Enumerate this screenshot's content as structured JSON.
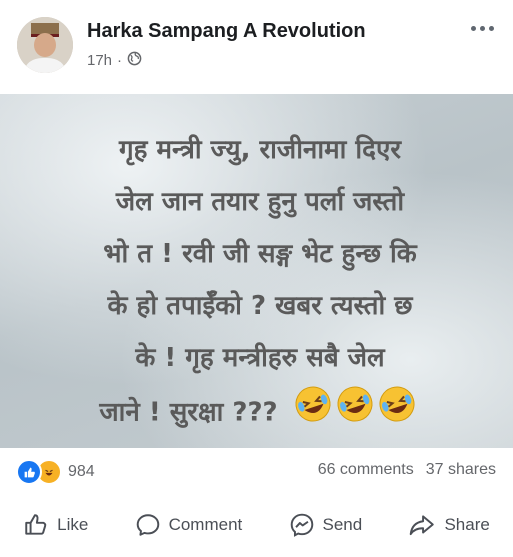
{
  "post": {
    "author": "Harka Sampang A Revolution",
    "time": "17h",
    "privacy_icon": "globe-icon",
    "text_lines": [
      "गृह मन्त्री ज्यु, राजीनामा दिएर",
      "जेल जान तयार हुनु पर्ला जस्तो",
      "भो त ! रवी जी सङ्ग भेट हुन्छ कि",
      "के हो तपाईँको ? खबर त्यस्तो छ",
      "के ! गृह मन्त्रीहरु सबै जेल",
      "जाने ! सुरक्षा ???"
    ],
    "emoji_count": 3,
    "text_color": "#5a5a5a"
  },
  "stats": {
    "reaction_count": "984",
    "comments": "66 comments",
    "shares": "37 shares"
  },
  "actions": {
    "like": "Like",
    "comment": "Comment",
    "send": "Send",
    "share": "Share"
  },
  "colors": {
    "like_blue": "#1877f2",
    "haha_yellow": "#f7b125",
    "secondary_text": "#65676b"
  }
}
